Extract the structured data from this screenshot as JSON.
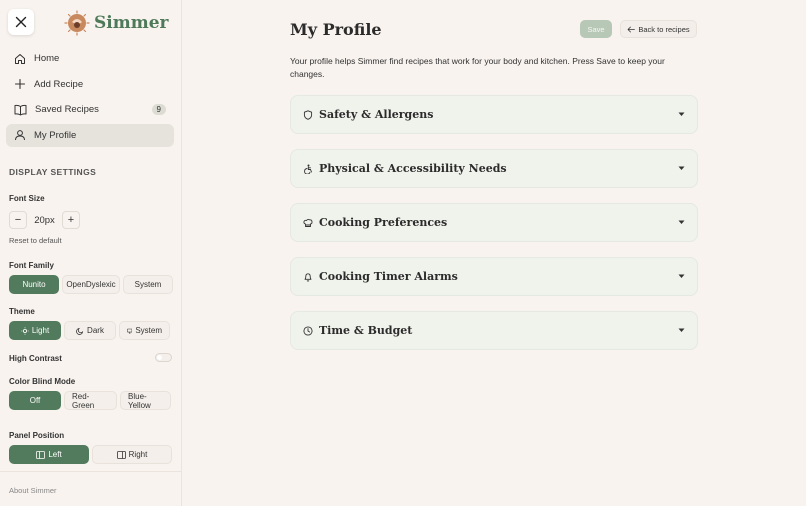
{
  "app": {
    "name": "Simmer"
  },
  "nav": [
    {
      "label": "Home",
      "icon": "home-icon"
    },
    {
      "label": "Add Recipe",
      "icon": "plus-icon"
    },
    {
      "label": "Saved Recipes",
      "icon": "book-icon",
      "badge": "9"
    },
    {
      "label": "My Profile",
      "icon": "user-icon",
      "active": true
    }
  ],
  "display_settings": {
    "heading": "DISPLAY SETTINGS",
    "font_size": {
      "label": "Font Size",
      "value": "20px",
      "decrement": "−",
      "increment": "+",
      "reset": "Reset to default"
    },
    "font_family": {
      "label": "Font Family",
      "options": [
        "Nunito",
        "OpenDyslexic",
        "System"
      ],
      "selected": "Nunito"
    },
    "theme": {
      "label": "Theme",
      "options": [
        "Light",
        "Dark",
        "System"
      ],
      "selected": "Light"
    },
    "high_contrast": {
      "label": "High Contrast",
      "on": false
    },
    "color_blind": {
      "label": "Color Blind Mode",
      "options": [
        "Off",
        "Red-Green",
        "Blue-Yellow"
      ],
      "selected": "Off"
    },
    "panel_position": {
      "label": "Panel Position",
      "options": [
        "Left",
        "Right"
      ],
      "selected": "Left"
    }
  },
  "footer": {
    "about": "About Simmer"
  },
  "main": {
    "title": "My Profile",
    "save_label": "Save",
    "back_label": "Back to recipes",
    "intro": "Your profile helps Simmer find recipes that work for your body and kitchen. Press Save to keep your changes.",
    "sections": [
      {
        "title": "Safety & Allergens",
        "icon": "shield-icon"
      },
      {
        "title": "Physical & Accessibility Needs",
        "icon": "accessibility-icon"
      },
      {
        "title": "Cooking Preferences",
        "icon": "chef-hat-icon"
      },
      {
        "title": "Cooking Timer Alarms",
        "icon": "bell-icon"
      },
      {
        "title": "Time & Budget",
        "icon": "clock-icon"
      }
    ]
  },
  "colors": {
    "accent": "#527a5c",
    "background": "#f8f3ef",
    "card": "#f0f2ec"
  }
}
